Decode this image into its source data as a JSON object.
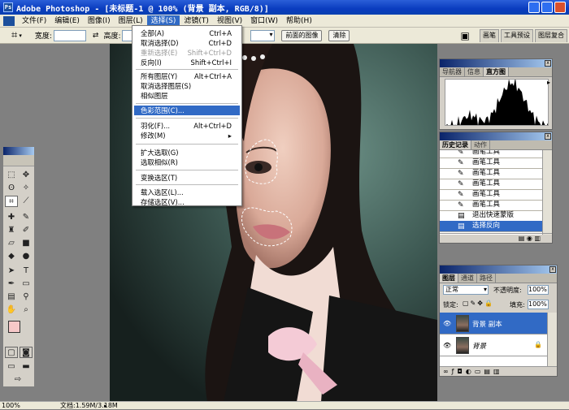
{
  "app": {
    "title": "Adobe Photoshop - [未标题-1 @ 100% (背景 副本, RGB/8)]",
    "logo": "Ps"
  },
  "menubar": [
    "文件(F)",
    "编辑(E)",
    "图像(I)",
    "图层(L)",
    "选择(S)",
    "滤镜(T)",
    "视图(V)",
    "窗口(W)",
    "帮助(H)"
  ],
  "options": {
    "width_label": "宽度:",
    "height_label": "高度:",
    "front_image_btn": "前面的图像",
    "clear_btn": "清除"
  },
  "palette_well": [
    "画笔",
    "工具预设",
    "图层复合"
  ],
  "select_menu": {
    "items": [
      {
        "label": "全部(A)",
        "shortcut": "Ctrl+A"
      },
      {
        "label": "取消选择(D)",
        "shortcut": "Ctrl+D"
      },
      {
        "label": "重新选择(E)",
        "shortcut": "Shift+Ctrl+D",
        "disabled": true
      },
      {
        "label": "反向(I)",
        "shortcut": "Shift+Ctrl+I"
      },
      {
        "label": "所有图层(Y)",
        "shortcut": "Alt+Ctrl+A"
      },
      {
        "label": "取消选择图层(S)",
        "shortcut": ""
      },
      {
        "label": "相似图层",
        "shortcut": ""
      },
      {
        "label": "色彩范围(C)...",
        "shortcut": "",
        "selected": true
      },
      {
        "label": "羽化(F)...",
        "shortcut": "Alt+Ctrl+D"
      },
      {
        "label": "修改(M)",
        "shortcut": "▸"
      },
      {
        "label": "扩大选取(G)",
        "shortcut": ""
      },
      {
        "label": "选取相似(R)",
        "shortcut": ""
      },
      {
        "label": "变换选区(T)",
        "shortcut": ""
      },
      {
        "label": "载入选区(L)...",
        "shortcut": ""
      },
      {
        "label": "存储选区(V)...",
        "shortcut": ""
      }
    ]
  },
  "navigator": {
    "tabs": [
      "导航器",
      "信息",
      "直方图"
    ],
    "active": 2
  },
  "history": {
    "tabs": [
      "历史记录",
      "动作"
    ],
    "items": [
      "画笔工具",
      "画笔工具",
      "画笔工具",
      "画笔工具",
      "画笔工具",
      "画笔工具",
      "退出快速蒙版",
      "选择反向"
    ],
    "selected": 7
  },
  "layers": {
    "tabs": [
      "图层",
      "通道",
      "路径"
    ],
    "blend_mode": "正常",
    "opacity_label": "不透明度:",
    "opacity": "100%",
    "lock_label": "锁定:",
    "fill_label": "填充:",
    "fill": "100%",
    "items": [
      {
        "name": "背景 副本",
        "selected": true
      },
      {
        "name": "背景",
        "locked": true
      }
    ]
  },
  "status": {
    "zoom": "100%",
    "doc": "文档:1.59M/3.18M"
  },
  "colors": {
    "foreground": "#f6c8c8",
    "background": "#e7921a",
    "selection": "#316ac5"
  }
}
